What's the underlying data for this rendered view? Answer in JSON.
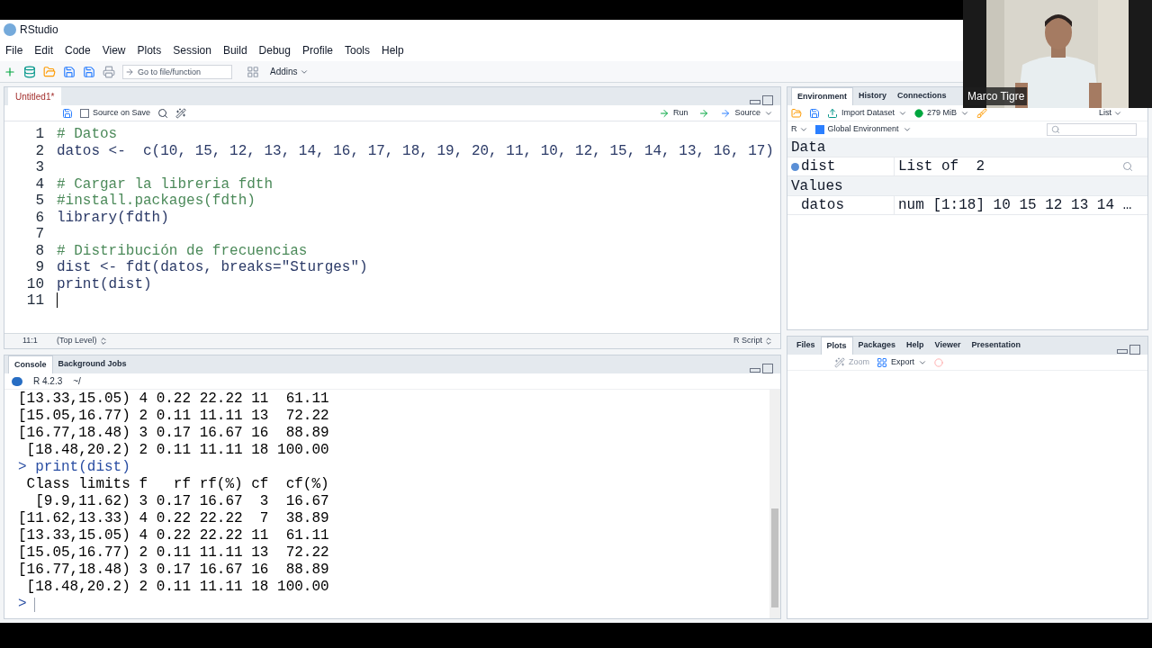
{
  "title_bar": {
    "title": "RStudio"
  },
  "menu": [
    "File",
    "Edit",
    "Code",
    "View",
    "Plots",
    "Session",
    "Build",
    "Debug",
    "Profile",
    "Tools",
    "Help"
  ],
  "toolbar": {
    "goto_placeholder": "Go to file/function",
    "addins": "Addins"
  },
  "editor": {
    "tabs": [
      {
        "label": "Untitled1*",
        "selected": true
      }
    ],
    "source_on_save": {
      "label": "Source on Save",
      "checked": false
    },
    "run": "Run",
    "source": "Source",
    "lines": [
      {
        "number": "1",
        "text": "# Datos",
        "kind": "comment"
      },
      {
        "number": "2",
        "text": "datos <-  c(10, 15, 12, 13, 14, 16, 17, 18, 19, 20, 11, 10, 12, 15, 14, 13, 16, 17)",
        "kind": "code"
      },
      {
        "number": "3",
        "kind": "blank"
      },
      {
        "number": "4",
        "text": "# Cargar la libreria fdth",
        "kind": "comment"
      },
      {
        "number": "5",
        "text": "#install.packages(fdth)",
        "kind": "comment"
      },
      {
        "number": "6",
        "text": "library(fdth)",
        "kind": "code"
      },
      {
        "number": "7",
        "kind": "blank"
      },
      {
        "number": "8",
        "text": "# Distribución de frecuencias",
        "kind": "comment"
      },
      {
        "number": "9",
        "text": "dist <- fdt(datos, breaks=\"Sturges\")",
        "kind": "code"
      },
      {
        "number": "10",
        "text": "print(dist)",
        "kind": "code"
      },
      {
        "number": "11",
        "kind": "cursor"
      }
    ],
    "status": {
      "position": "11:1",
      "scope": "(Top Level)",
      "filetype": "R Script"
    }
  },
  "console": {
    "tabs": [
      {
        "label": "Console",
        "selected": true
      },
      {
        "label": "Background Jobs",
        "selected": false
      }
    ],
    "version": "R 4.2.3",
    "path": "~/",
    "lines": [
      {
        "text": "[13.33,15.05) 4 0.22 22.22 11  61.11",
        "kind": "output"
      },
      {
        "text": "[15.05,16.77) 2 0.11 11.11 13  72.22",
        "kind": "output"
      },
      {
        "text": "[16.77,18.48) 3 0.17 16.67 16  88.89",
        "kind": "output"
      },
      {
        "text": " [18.48,20.2) 2 0.11 11.11 18 100.00",
        "kind": "output"
      },
      {
        "text": "> print(dist)",
        "kind": "input"
      },
      {
        "text": " Class limits f   rf rf(%) cf  cf(%)",
        "kind": "output"
      },
      {
        "text": "  [9.9,11.62) 3 0.17 16.67  3  16.67",
        "kind": "output"
      },
      {
        "text": "[11.62,13.33) 4 0.22 22.22  7  38.89",
        "kind": "output"
      },
      {
        "text": "[13.33,15.05) 4 0.22 22.22 11  61.11",
        "kind": "output"
      },
      {
        "text": "[15.05,16.77) 2 0.11 11.11 13  72.22",
        "kind": "output"
      },
      {
        "text": "[16.77,18.48) 3 0.17 16.67 16  88.89",
        "kind": "output"
      },
      {
        "text": " [18.48,20.2) 2 0.11 11.11 18 100.00",
        "kind": "output"
      },
      {
        "text": ">",
        "kind": "prompt"
      }
    ]
  },
  "environment": {
    "tabs": [
      {
        "label": "Environment",
        "selected": true
      },
      {
        "label": "History",
        "selected": false
      },
      {
        "label": "Connections",
        "selected": false
      }
    ],
    "import": "Import Dataset",
    "memory": "279 MiB",
    "view": "List",
    "language": "R",
    "scope": "Global Environment",
    "sections": [
      {
        "title": "Data",
        "rows": [
          {
            "name": "dist",
            "value": "List of  2",
            "kind": "data"
          }
        ]
      },
      {
        "title": "Values",
        "rows": [
          {
            "name": "datos",
            "value": "num [1:18] 10 15 12 13 14 …",
            "kind": "value"
          }
        ]
      }
    ]
  },
  "files_pane": {
    "tabs": [
      {
        "label": "Files",
        "selected": false
      },
      {
        "label": "Plots",
        "selected": true
      },
      {
        "label": "Packages",
        "selected": false
      },
      {
        "label": "Help",
        "selected": false
      },
      {
        "label": "Viewer",
        "selected": false
      },
      {
        "label": "Presentation",
        "selected": false
      }
    ],
    "zoom": "Zoom",
    "export": "Export"
  },
  "webcam": {
    "name": "Marco Tigre"
  }
}
